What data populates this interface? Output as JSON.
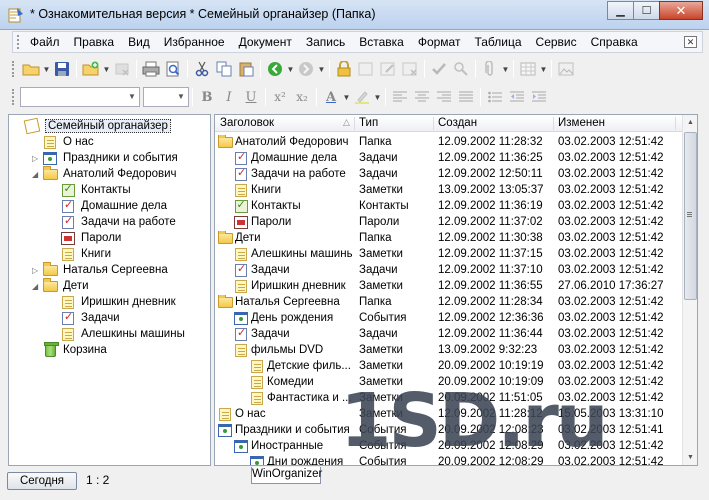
{
  "window": {
    "title": "* Ознакомительная версия * Семейный органайзер (Папка)",
    "controls": [
      "minimize",
      "maximize",
      "close"
    ]
  },
  "menu": {
    "items": [
      "Файл",
      "Правка",
      "Вид",
      "Избранное",
      "Документ",
      "Запись",
      "Вставка",
      "Формат",
      "Таблица",
      "Сервис",
      "Справка"
    ]
  },
  "toolbar1": {
    "icons": [
      "open-folder-icon",
      "save-icon",
      "new-record-icon",
      "delete-record-icon",
      "print-icon",
      "print-preview-icon",
      "cut-icon",
      "copy-icon",
      "paste-icon",
      "back-icon",
      "forward-icon",
      "lock-icon",
      "note-add-icon",
      "note-edit-icon",
      "note-delete-icon",
      "check-icon",
      "search-icon",
      "attach-icon",
      "table-insert-icon",
      "image-insert-icon"
    ]
  },
  "toolbar2": {
    "font_name": "",
    "font_size": "",
    "format": [
      "B",
      "I",
      "U",
      "x²",
      "x₂",
      "A"
    ]
  },
  "tree": {
    "items": [
      {
        "label": "Семейный органайзер",
        "icon": "app-icon",
        "level": 0,
        "expander": "",
        "selected": true
      },
      {
        "label": "О нас",
        "icon": "note-icon",
        "level": 1,
        "expander": ""
      },
      {
        "label": "Праздники и события",
        "icon": "event-icon",
        "level": 1,
        "expander": "▷"
      },
      {
        "label": "Анатолий Федорович",
        "icon": "folder-icon",
        "level": 1,
        "expander": "◢"
      },
      {
        "label": "Контакты",
        "icon": "contact-icon",
        "level": 2,
        "expander": ""
      },
      {
        "label": "Домашние дела",
        "icon": "task-icon",
        "level": 2,
        "expander": ""
      },
      {
        "label": "Задачи на работе",
        "icon": "task-icon",
        "level": 2,
        "expander": ""
      },
      {
        "label": "Пароли",
        "icon": "password-icon",
        "level": 2,
        "expander": ""
      },
      {
        "label": "Книги",
        "icon": "note-icon",
        "level": 2,
        "expander": ""
      },
      {
        "label": "Наталья Сергеевна",
        "icon": "folder-icon",
        "level": 1,
        "expander": "▷"
      },
      {
        "label": "Дети",
        "icon": "folder-icon",
        "level": 1,
        "expander": "◢"
      },
      {
        "label": "Иришкин дневник",
        "icon": "note-icon",
        "level": 2,
        "expander": ""
      },
      {
        "label": "Задачи",
        "icon": "task-icon",
        "level": 2,
        "expander": ""
      },
      {
        "label": "Алешкины машины",
        "icon": "note-icon",
        "level": 2,
        "expander": ""
      },
      {
        "label": "Корзина",
        "icon": "trash-icon",
        "level": 1,
        "expander": ""
      }
    ]
  },
  "table": {
    "columns": [
      "Заголовок",
      "Тип",
      "Создан",
      "Изменен"
    ],
    "sort_indicator": "△",
    "rows": [
      {
        "title": "Анатолий Федорович",
        "type": "Папка",
        "created": "12.09.2002 11:28:32",
        "modified": "03.02.2003 12:51:42",
        "icon": "folder-icon",
        "level": 0
      },
      {
        "title": "Домашние дела",
        "type": "Задачи",
        "created": "12.09.2002 11:36:25",
        "modified": "03.02.2003 12:51:42",
        "icon": "task-icon",
        "level": 1
      },
      {
        "title": "Задачи на работе",
        "type": "Задачи",
        "created": "12.09.2002 12:50:11",
        "modified": "03.02.2003 12:51:42",
        "icon": "task-icon",
        "level": 1
      },
      {
        "title": "Книги",
        "type": "Заметки",
        "created": "13.09.2002 13:05:37",
        "modified": "03.02.2003 12:51:42",
        "icon": "note-icon",
        "level": 1
      },
      {
        "title": "Контакты",
        "type": "Контакты",
        "created": "12.09.2002 11:36:19",
        "modified": "03.02.2003 12:51:42",
        "icon": "contact-icon",
        "level": 1
      },
      {
        "title": "Пароли",
        "type": "Пароли",
        "created": "12.09.2002 11:37:02",
        "modified": "03.02.2003 12:51:42",
        "icon": "password-icon",
        "level": 1
      },
      {
        "title": "Дети",
        "type": "Папка",
        "created": "12.09.2002 11:30:38",
        "modified": "03.02.2003 12:51:42",
        "icon": "folder-icon",
        "level": 0
      },
      {
        "title": "Алешкины машины",
        "type": "Заметки",
        "created": "12.09.2002 11:37:15",
        "modified": "03.02.2003 12:51:42",
        "icon": "note-icon",
        "level": 1
      },
      {
        "title": "Задачи",
        "type": "Задачи",
        "created": "12.09.2002 11:37:10",
        "modified": "03.02.2003 12:51:42",
        "icon": "task-icon",
        "level": 1
      },
      {
        "title": "Иришкин дневник",
        "type": "Заметки",
        "created": "12.09.2002 11:36:55",
        "modified": "27.06.2010 17:36:27",
        "icon": "note-icon",
        "level": 1
      },
      {
        "title": "Наталья Сергеевна",
        "type": "Папка",
        "created": "12.09.2002 11:28:34",
        "modified": "03.02.2003 12:51:42",
        "icon": "folder-icon",
        "level": 0
      },
      {
        "title": "День рождения",
        "type": "События",
        "created": "12.09.2002 12:36:36",
        "modified": "03.02.2003 12:51:42",
        "icon": "event-icon",
        "level": 1
      },
      {
        "title": "Задачи",
        "type": "Задачи",
        "created": "12.09.2002 11:36:44",
        "modified": "03.02.2003 12:51:42",
        "icon": "task-icon",
        "level": 1
      },
      {
        "title": "фильмы DVD",
        "type": "Заметки",
        "created": "13.09.2002 9:32:23",
        "modified": "03.02.2003 12:51:42",
        "icon": "note-icon",
        "level": 1
      },
      {
        "title": "Детские филь...",
        "type": "Заметки",
        "created": "20.09.2002 10:19:19",
        "modified": "03.02.2003 12:51:42",
        "icon": "note-icon",
        "level": 2
      },
      {
        "title": "Комедии",
        "type": "Заметки",
        "created": "20.09.2002 10:19:09",
        "modified": "03.02.2003 12:51:42",
        "icon": "note-icon",
        "level": 2
      },
      {
        "title": "Фантастика и ...",
        "type": "Заметки",
        "created": "20.09.2002 11:51:05",
        "modified": "03.02.2003 12:51:42",
        "icon": "note-icon",
        "level": 2
      },
      {
        "title": "О нас",
        "type": "Заметки",
        "created": "12.09.2002 11:28:12",
        "modified": "15.05.2003 13:31:10",
        "icon": "note-icon",
        "level": 0
      },
      {
        "title": "Праздники и события",
        "type": "События",
        "created": "20.09.2002 12:08:23",
        "modified": "03.02.2003 12:51:41",
        "icon": "event-icon",
        "level": 0
      },
      {
        "title": "Иностранные",
        "type": "События",
        "created": "20.09.2002 12:08:29",
        "modified": "03.02.2003 12:51:42",
        "icon": "event-icon",
        "level": 1
      },
      {
        "title": "Дни рождения",
        "type": "События",
        "created": "20.09.2002 12:08:29",
        "modified": "03.02.2003 12:51:42",
        "icon": "event-icon",
        "level": 2
      }
    ]
  },
  "statusbar": {
    "today_label": "Сегодня",
    "counter": "1 : 2",
    "tab_label": "WinOrganizer"
  },
  "watermark": {
    "text": "1SD.ru"
  }
}
